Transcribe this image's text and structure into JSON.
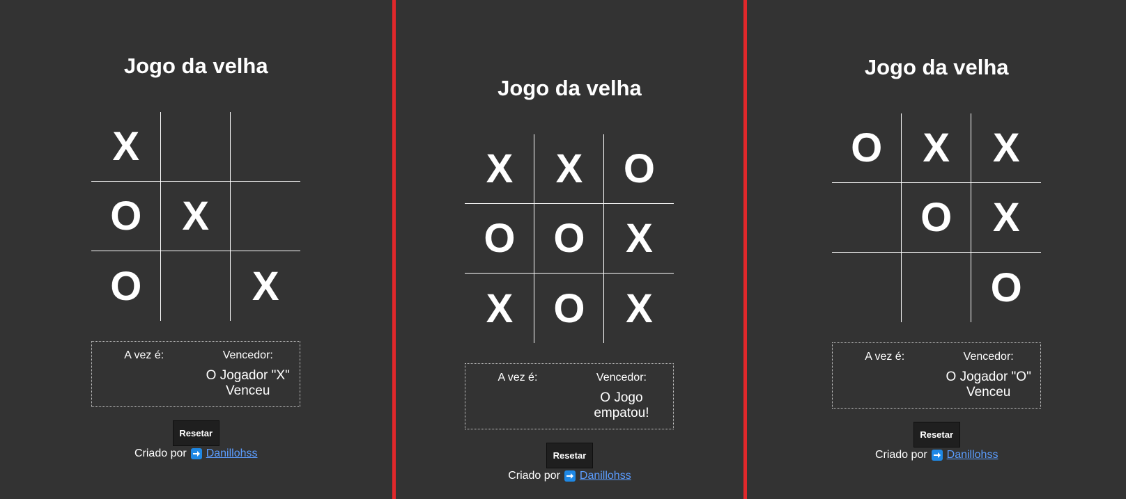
{
  "colors": {
    "background": "#333333",
    "divider": "#e0282b",
    "link": "#5b9dff",
    "text": "#ffffff"
  },
  "panels": [
    {
      "title": "Jogo da velha",
      "board": [
        "X",
        "",
        "",
        "O",
        "X",
        "",
        "O",
        "",
        "X"
      ],
      "turn_label": "A vez é:",
      "turn_value": "",
      "winner_label": "Vencedor:",
      "winner_value": "O Jogador \"X\" Venceu",
      "reset_label": "Resetar",
      "credit_text": "Criado por",
      "credit_icon": "arrow-right-icon",
      "credit_link": "Danillohss"
    },
    {
      "title": "Jogo da velha",
      "board": [
        "X",
        "X",
        "O",
        "O",
        "O",
        "X",
        "X",
        "O",
        "X"
      ],
      "turn_label": "A vez é:",
      "turn_value": "",
      "winner_label": "Vencedor:",
      "winner_value": "O Jogo empatou!",
      "reset_label": "Resetar",
      "credit_text": "Criado por",
      "credit_icon": "arrow-right-icon",
      "credit_link": "Danillohss"
    },
    {
      "title": "Jogo da velha",
      "board": [
        "O",
        "X",
        "X",
        "",
        "O",
        "X",
        "",
        "",
        "O"
      ],
      "turn_label": "A vez é:",
      "turn_value": "",
      "winner_label": "Vencedor:",
      "winner_value": "O Jogador \"O\" Venceu",
      "reset_label": "Resetar",
      "credit_text": "Criado por",
      "credit_icon": "arrow-right-icon",
      "credit_link": "Danillohss"
    }
  ]
}
